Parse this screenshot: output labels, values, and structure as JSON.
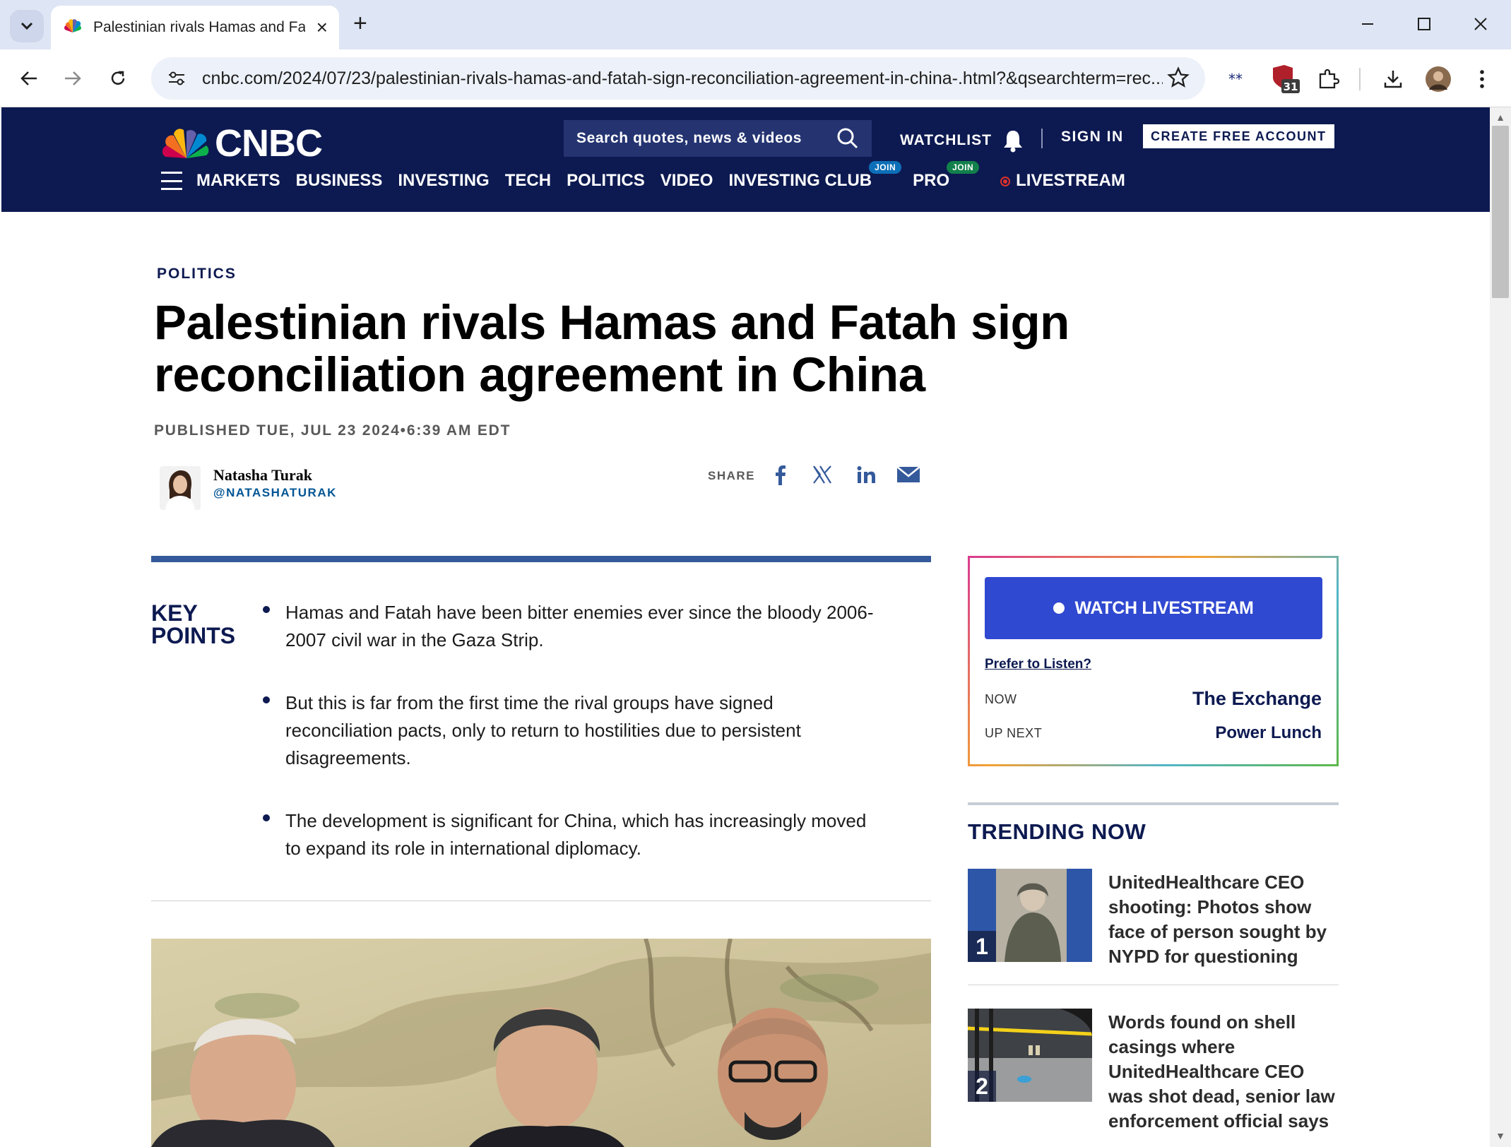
{
  "browser": {
    "tab_title": "Palestinian rivals Hamas and Fatah sign",
    "url": "cnbc.com/2024/07/23/palestinian-rivals-hamas-and-fatah-sign-reconciliation-agreement-in-china-.html?&qsearchterm=rec...",
    "extension_badge": "31"
  },
  "header": {
    "logo_text": "CNBC",
    "search_placeholder": "Search quotes, news & videos",
    "watchlist": "WATCHLIST",
    "sign_in": "SIGN IN",
    "create_account": "CREATE FREE ACCOUNT",
    "nav": {
      "markets": "MARKETS",
      "business": "BUSINESS",
      "investing": "INVESTING",
      "tech": "TECH",
      "politics": "POLITICS",
      "video": "VIDEO",
      "investing_club": "INVESTING CLUB",
      "pro": "PRO",
      "livestream": "LIVESTREAM",
      "join": "JOIN"
    }
  },
  "article": {
    "section": "POLITICS",
    "headline": "Palestinian rivals Hamas and Fatah sign reconciliation agreement in China",
    "published": "PUBLISHED TUE, JUL 23 2024•6:39 AM EDT",
    "author_name": "Natasha Turak",
    "author_handle": "@NATASHATURAK",
    "share_label": "SHARE",
    "key_points_title_1": "KEY",
    "key_points_title_2": "POINTS",
    "key_points": [
      "Hamas and Fatah have been bitter enemies ever since the bloody 2006-2007 civil war in the Gaza Strip.",
      "But this is far from the first time the rival groups have signed reconciliation pacts, only to return to hostilities due to persistent disagreements.",
      "The development is significant for China, which has increasingly moved to expand its role in international diplomacy."
    ]
  },
  "sidebar": {
    "watch_livestream": "WATCH LIVESTREAM",
    "prefer_listen": "Prefer to Listen?",
    "now_label": "NOW",
    "now_show": "The Exchange",
    "next_label": "UP NEXT",
    "next_show": "Power Lunch",
    "trending_title": "TRENDING NOW",
    "trending": [
      {
        "rank": "1",
        "text": "UnitedHealthcare CEO shooting: Photos show face of person sought by NYPD for questioning"
      },
      {
        "rank": "2",
        "text": "Words found on shell casings where UnitedHealthcare CEO was shot dead, senior law enforcement official says"
      }
    ]
  },
  "colors": {
    "navy": "#0d1a51",
    "watch_button": "#3049d1",
    "key_points_bar": "#355a9b"
  }
}
